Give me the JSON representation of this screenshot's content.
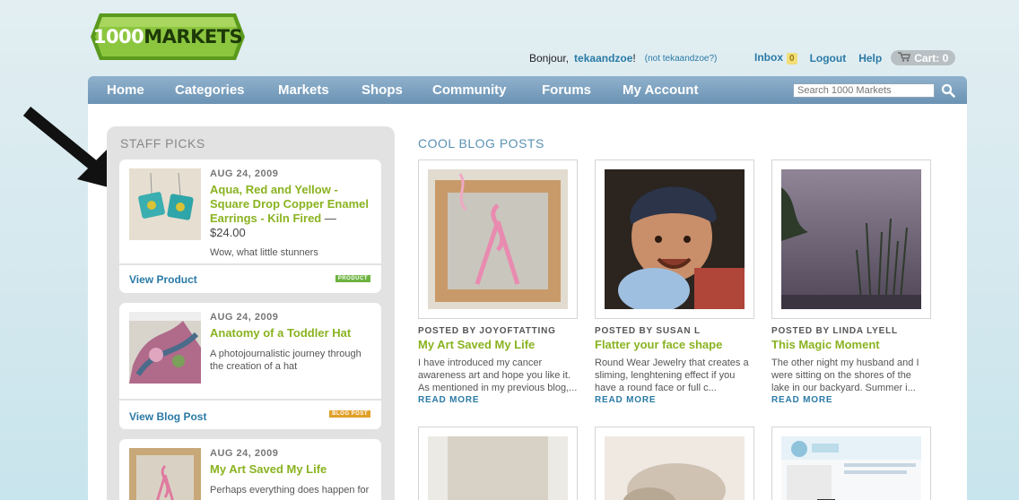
{
  "logo": {
    "num": "1000",
    "word": "MARKETS"
  },
  "user": {
    "greeting": "Bonjour,",
    "username": "tekaandzoe",
    "excl": "!",
    "not_user": "(not tekaandzoe?)"
  },
  "topnav": {
    "inbox": "Inbox",
    "inbox_count": "0",
    "logout": "Logout",
    "help": "Help",
    "cart": "Cart: 0"
  },
  "nav": {
    "items": [
      "Home",
      "Categories",
      "Markets",
      "Shops",
      "Community",
      "Forums",
      "My Account"
    ],
    "search_placeholder": "Search 1000 Markets"
  },
  "staff_picks": {
    "title": "STAFF PICKS",
    "items": [
      {
        "date": "AUG 24, 2009",
        "title": "Aqua, Red and Yellow - Square Drop Copper Enamel Earrings - Kiln Fired",
        "price": "— $24.00",
        "desc": "Wow, what little stunners",
        "view": "View Product",
        "tag": "PRODUCT"
      },
      {
        "date": "AUG 24, 2009",
        "title": "Anatomy of a Toddler Hat",
        "desc": "A photojournalistic journey through the creation of a hat",
        "view": "View Blog Post",
        "tag": "BLOG POST"
      },
      {
        "date": "AUG 24, 2009",
        "title": "My Art Saved My Life",
        "desc": "Perhaps everything does happen for"
      }
    ]
  },
  "blog": {
    "title": "COOL BLOG POSTS",
    "posts": [
      {
        "posted": "POSTED BY JOYOFTATTING",
        "title": "My Art Saved My Life",
        "desc": "I have introduced my cancer awareness art and hope you like it. As mentioned in my previous blog,...",
        "more": "READ MORE"
      },
      {
        "posted": "POSTED BY SUSAN L",
        "title": "Flatter your face shape",
        "desc": "Round Wear Jewelry that creates a sliming, lenghtening effect if you have a round face or full c...",
        "more": "READ MORE"
      },
      {
        "posted": "POSTED BY LINDA LYELL",
        "title": "This Magic Moment",
        "desc": "The other night my husband and I were sitting on the shores of the lake in our backyard. Summer i...",
        "more": "READ MORE"
      }
    ]
  },
  "colors": {
    "accent_green": "#8ab320",
    "link_blue": "#2a7aa6",
    "nav_blue": "#7a9fbf"
  }
}
